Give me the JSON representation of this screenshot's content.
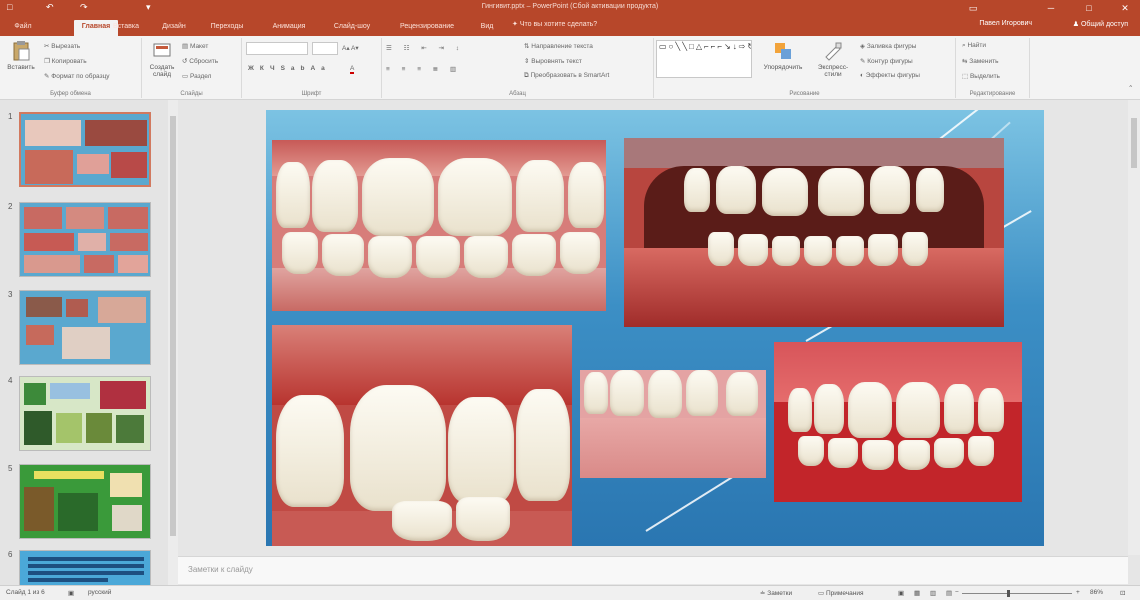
{
  "titlebar": {
    "quick_access": {
      "undo": "↶",
      "redo": "↷",
      "save": "□",
      "customize": "▾"
    },
    "doc_title": "Гингивит.pptx – PowerPoint (Сбой активации продукта)",
    "user": "Павел Игорович",
    "share_label": "Общий доступ",
    "win_min": "─",
    "win_max": "□",
    "win_close": "✕",
    "win_restore": "▭"
  },
  "tabs": [
    "Файл",
    "Главная",
    "Вставка",
    "Дизайн",
    "Переходы",
    "Анимация",
    "Слайд-шоу",
    "Рецензирование",
    "Вид"
  ],
  "active_tab": "Главная",
  "tell_me": "Что вы хотите сделать?",
  "ribbon": {
    "clipboard": {
      "label": "Буфер обмена",
      "paste": "Вставить",
      "cut": "Вырезать",
      "copy": "Копировать",
      "format_painter": "Формат по образцу"
    },
    "slides": {
      "label": "Слайды",
      "new_slide": "Создать слайд",
      "layout": "Макет",
      "reset": "Сбросить",
      "section": "Раздел"
    },
    "font": {
      "label": "Шрифт",
      "font_name": "",
      "font_size": ""
    },
    "paragraph": {
      "label": "Абзац",
      "text_direction": "Направление текста",
      "align_text": "Выровнять текст",
      "smartart": "Преобразовать в SmartArt"
    },
    "drawing": {
      "label": "Рисование",
      "arrange": "Упорядочить",
      "quick_styles": "Экспресс-стили",
      "shape_fill": "Заливка фигуры",
      "shape_outline": "Контур фигуры",
      "shape_effects": "Эффекты фигуры"
    },
    "editing": {
      "label": "Редактирование",
      "find": "Найти",
      "replace": "Заменить",
      "select": "Выделить"
    }
  },
  "slides_list": [
    {
      "num": "1"
    },
    {
      "num": "2"
    },
    {
      "num": "3"
    },
    {
      "num": "4"
    },
    {
      "num": "5"
    },
    {
      "num": "6"
    }
  ],
  "notes_placeholder": "Заметки к слайду",
  "status": {
    "slide_of": "Слайд 1 из 6",
    "language": "русский",
    "notes": "Заметки",
    "comments": "Примечания",
    "zoom_percent": 86,
    "zoom": "86%"
  }
}
